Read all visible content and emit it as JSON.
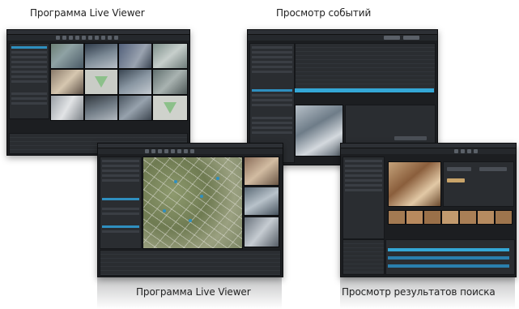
{
  "captions": {
    "top_left": "Программа Live Viewer",
    "top_right": "Просмотр событий",
    "bottom_left": "Программа Live Viewer",
    "bottom_right": "Просмотр результатов поиска"
  },
  "colors": {
    "window_bg": "#1c1e21",
    "panel_bg": "#2a2d31",
    "accent": "#2f8fbf",
    "highlight": "#34a7d6",
    "caption_text": "#222222"
  }
}
